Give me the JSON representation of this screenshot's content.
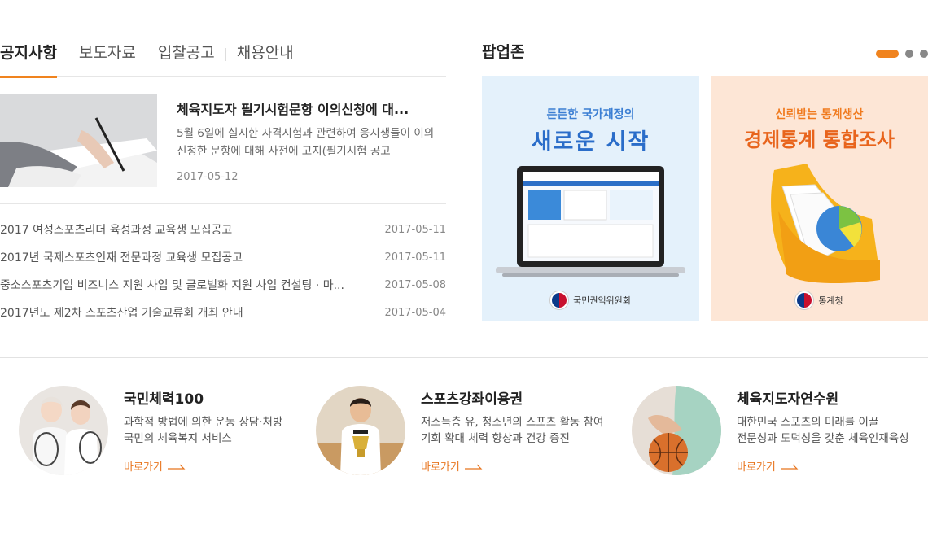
{
  "notice": {
    "tabs": [
      "공지사항",
      "보도자료",
      "입찰공고",
      "채용안내"
    ],
    "featured": {
      "title": "체육지도자 필기시험문항 이의신청에 대...",
      "desc": "5월 6일에 실시한 자격시험과 관련하여 응시생들이 이의 신청한 문항에 대해 사전에 고지(필기시험 공고",
      "date": "2017-05-12"
    },
    "items": [
      {
        "title": "2017 여성스포츠리더 육성과정 교육생 모집공고",
        "date": "2017-05-11"
      },
      {
        "title": "2017년 국제스포츠인재 전문과정 교육생 모집공고",
        "date": "2017-05-11"
      },
      {
        "title": "중소스포츠기업 비즈니스 지원 사업 및 글로벌화 지원 사업 컨설팅 · 마...",
        "date": "2017-05-08"
      },
      {
        "title": "2017년도 제2차 스포츠산업 기술교류회 개최 안내",
        "date": "2017-05-04"
      }
    ]
  },
  "popup": {
    "title": "팝업존",
    "banners": [
      {
        "sub": "튼튼한 국가재정의",
        "main": "새로운 시작",
        "org": "국민권익위원회"
      },
      {
        "sub": "신뢰받는 통계생산",
        "main": "경제통계 통합조사",
        "org": "통계청"
      }
    ]
  },
  "quick": [
    {
      "title": "국민체력100",
      "desc1": "과학적 방법에 의한 운동 상담·처방",
      "desc2": "국민의 체육복지 서비스",
      "link": "바로가기"
    },
    {
      "title": "스포츠강좌이용권",
      "desc1": "저소득층 유, 청소년의 스포츠 활동 참여",
      "desc2": "기회 확대 체력 향상과 건강 증진",
      "link": "바로가기"
    },
    {
      "title": "체육지도자연수원",
      "desc1": "대한민국 스포츠의 미래를 이끌",
      "desc2": "전문성과 도덕성을 갖춘 체육인재육성",
      "link": "바로가기"
    }
  ],
  "colors": {
    "accent": "#f0831e",
    "link": "#e8741c"
  }
}
